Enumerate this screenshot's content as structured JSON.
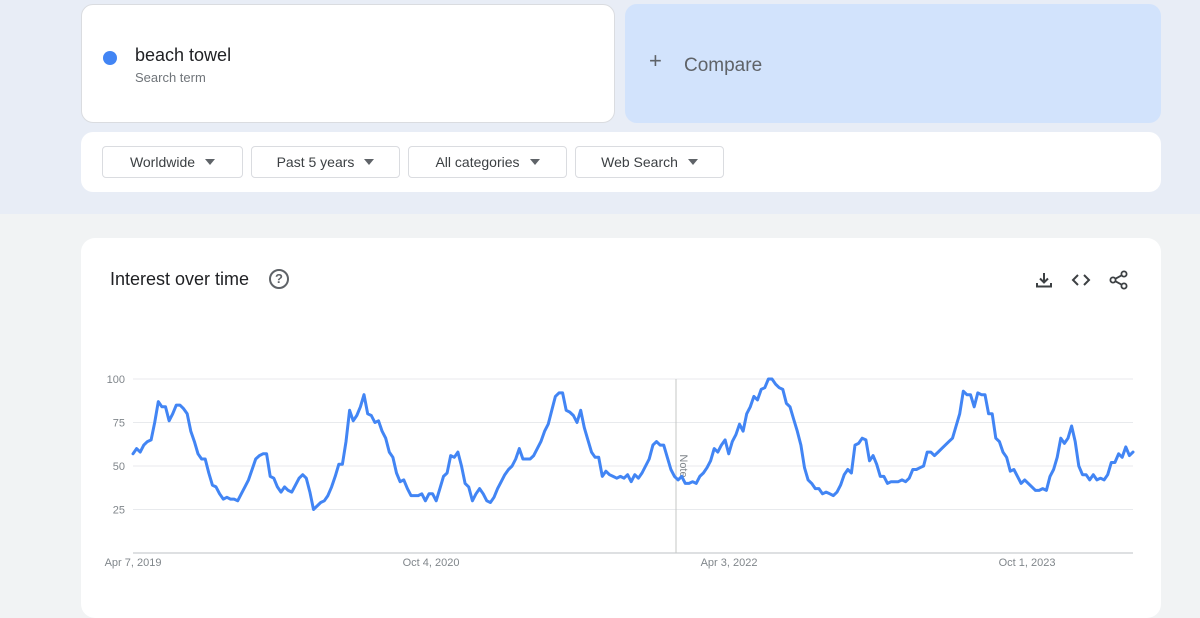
{
  "search_term": {
    "name": "beach towel",
    "subtitle": "Search term",
    "color": "#4285f4"
  },
  "compare": {
    "label": "Compare"
  },
  "filters": {
    "region": "Worldwide",
    "time": "Past 5 years",
    "category": "All categories",
    "search_type": "Web Search"
  },
  "chart_section": {
    "title": "Interest over time",
    "icons": [
      "help-icon",
      "download-icon",
      "embed-icon",
      "share-icon"
    ]
  },
  "chart_data": {
    "type": "line",
    "title": "Interest over time",
    "xlabel": "",
    "ylabel": "",
    "ylim": [
      0,
      100
    ],
    "y_ticks": [
      25,
      50,
      75,
      100
    ],
    "x_tick_labels": [
      "Apr 7, 2019",
      "Oct 4, 2020",
      "Apr 3, 2022",
      "Oct 1, 2023"
    ],
    "annotation": "Note",
    "grid": true,
    "series": [
      {
        "name": "beach towel",
        "color": "#4285f4",
        "values": [
          57,
          60,
          58,
          62,
          64,
          65,
          75,
          87,
          84,
          84,
          76,
          80,
          85,
          85,
          83,
          80,
          70,
          64,
          57,
          54,
          54,
          46,
          39,
          38,
          34,
          31,
          32,
          31,
          31,
          30,
          34,
          38,
          42,
          48,
          54,
          56,
          57,
          57,
          44,
          43,
          38,
          35,
          38,
          36,
          35,
          39,
          43,
          45,
          43,
          35,
          25,
          27,
          29,
          30,
          33,
          38,
          44,
          51,
          51,
          64,
          82,
          76,
          79,
          84,
          91,
          80,
          79,
          75,
          76,
          70,
          66,
          58,
          55,
          46,
          41,
          42,
          37,
          33,
          33,
          33,
          34,
          30,
          34,
          34,
          30,
          37,
          44,
          46,
          56,
          55,
          58,
          50,
          40,
          38,
          30,
          34,
          37,
          34,
          30,
          29,
          32,
          37,
          41,
          45,
          48,
          50,
          54,
          60,
          54,
          54,
          54,
          56,
          60,
          64,
          70,
          74,
          82,
          90,
          92,
          92,
          82,
          81,
          79,
          75,
          82,
          72,
          65,
          58,
          55,
          55,
          44,
          47,
          45,
          44,
          43,
          44,
          43,
          45,
          41,
          45,
          43,
          46,
          50,
          54,
          62,
          64,
          62,
          62,
          55,
          48,
          44,
          42,
          44,
          40,
          40,
          41,
          40,
          44,
          46,
          49,
          53,
          60,
          58,
          62,
          65,
          57,
          64,
          68,
          74,
          70,
          80,
          84,
          90,
          88,
          94,
          95,
          100,
          100,
          97,
          95,
          94,
          86,
          84,
          77,
          70,
          62,
          49,
          42,
          40,
          37,
          37,
          34,
          35,
          34,
          33,
          35,
          39,
          45,
          48,
          46,
          62,
          63,
          66,
          65,
          53,
          56,
          51,
          44,
          44,
          40,
          41,
          41,
          41,
          42,
          41,
          43,
          48,
          48,
          49,
          50,
          58,
          58,
          56,
          58,
          60,
          62,
          64,
          66,
          73,
          80,
          93,
          91,
          91,
          84,
          92,
          91,
          91,
          80,
          80,
          66,
          64,
          58,
          55,
          47,
          48,
          44,
          40,
          42,
          40,
          38,
          36,
          36,
          37,
          36,
          44,
          48,
          55,
          66,
          63,
          66,
          73,
          64,
          50,
          45,
          45,
          42,
          45,
          42,
          43,
          42,
          45,
          52,
          52,
          57,
          55,
          61,
          56,
          58
        ]
      }
    ]
  }
}
